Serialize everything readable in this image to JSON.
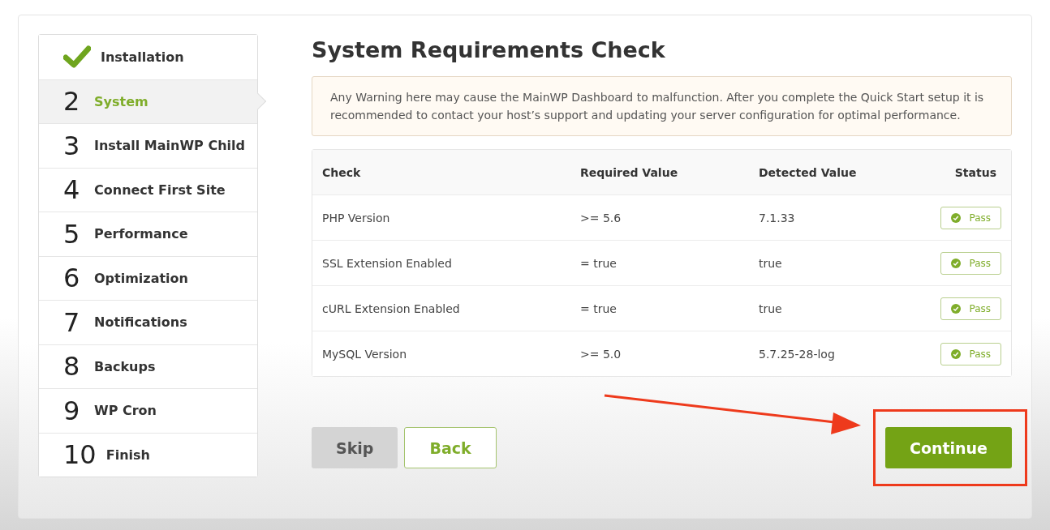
{
  "steps": [
    {
      "kind": "done",
      "label": "Installation",
      "selected": false
    },
    {
      "kind": "numbered",
      "number": "2",
      "label": "System",
      "selected": true
    },
    {
      "kind": "numbered",
      "number": "3",
      "label": "Install MainWP Child",
      "selected": false
    },
    {
      "kind": "numbered",
      "number": "4",
      "label": "Connect First Site",
      "selected": false
    },
    {
      "kind": "numbered",
      "number": "5",
      "label": "Performance",
      "selected": false
    },
    {
      "kind": "numbered",
      "number": "6",
      "label": "Optimization",
      "selected": false
    },
    {
      "kind": "numbered",
      "number": "7",
      "label": "Notifications",
      "selected": false
    },
    {
      "kind": "numbered",
      "number": "8",
      "label": "Backups",
      "selected": false
    },
    {
      "kind": "numbered",
      "number": "9",
      "label": "WP Cron",
      "selected": false
    },
    {
      "kind": "numbered",
      "number": "10",
      "label": "Finish",
      "selected": false
    }
  ],
  "title": "System Requirements Check",
  "warning": "Any Warning here may cause the MainWP Dashboard to malfunction. After you complete the Quick Start setup it is recommended to contact your host’s support and updating your server configuration for optimal performance.",
  "table": {
    "columns": [
      "Check",
      "Required Value",
      "Detected Value",
      "Status"
    ],
    "rows": [
      {
        "check": "PHP Version",
        "required": ">= 5.6",
        "detected": "7.1.33",
        "status": "Pass",
        "passed": true
      },
      {
        "check": "SSL Extension Enabled",
        "required": "= true",
        "detected": "true",
        "status": "Pass",
        "passed": true
      },
      {
        "check": "cURL Extension Enabled",
        "required": "= true",
        "detected": "true",
        "status": "Pass",
        "passed": true
      },
      {
        "check": "MySQL Version",
        "required": ">= 5.0",
        "detected": "5.7.25-28-log",
        "status": "Pass",
        "passed": true
      }
    ]
  },
  "buttons": [
    {
      "kind": "grey",
      "label": "Skip"
    },
    {
      "kind": "outline",
      "label": "Back"
    },
    {
      "kind": "primary",
      "label": "Continue"
    }
  ],
  "annotation": {
    "highlight": true
  }
}
